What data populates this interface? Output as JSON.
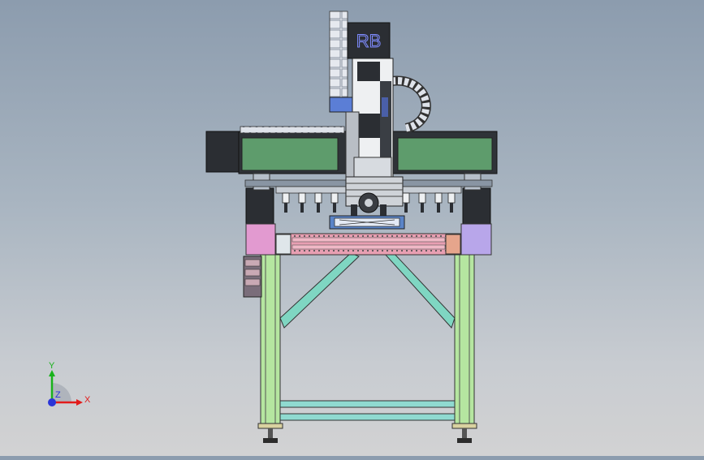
{
  "model": {
    "brand_label": "RB",
    "colors": {
      "background_top": "#8c9cae",
      "background_bottom": "#d2d2d3",
      "frame_green": "#b5e6a0",
      "frame_pink": "#e8a0b4",
      "brace_teal": "#7fd6c2",
      "gantry_panel": "#5e9c6c",
      "side_block_pink": "#e29ad0",
      "side_block_purple": "#b8a6ea",
      "drag_chain": "#dfe3ea",
      "motor_body": "#2b2e33"
    }
  },
  "triad": {
    "x_label": "X",
    "y_label": "Y",
    "z_label": "Z",
    "x_color": "#e21b1b",
    "y_color": "#19b21b",
    "z_color": "#2a35d8"
  }
}
